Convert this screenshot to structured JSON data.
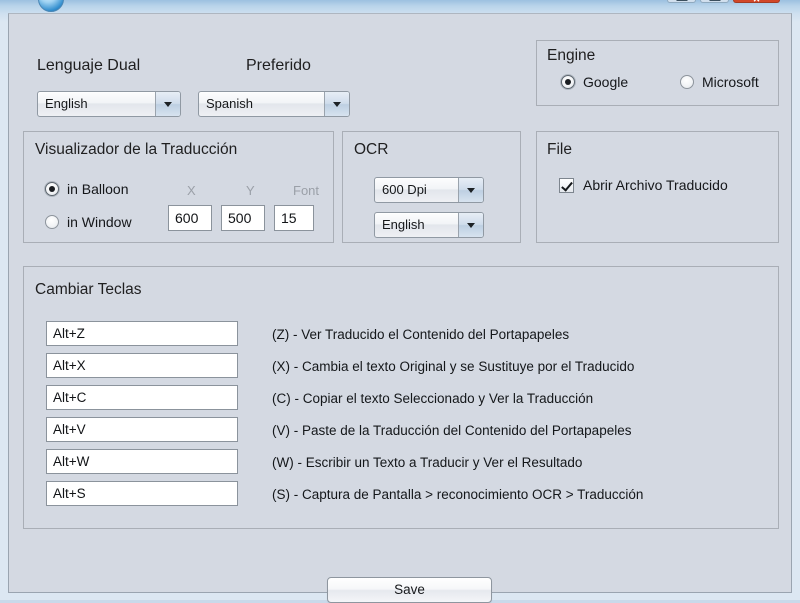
{
  "window": {
    "controls": {
      "minimize": "Minimize",
      "maximize": "Maximize",
      "close": "✕"
    },
    "app_icon": "globe-icon"
  },
  "languages": {
    "dual_label": "Lenguaje Dual",
    "preferred_label": "Preferido",
    "dual_value": "English",
    "preferred_value": "Spanish"
  },
  "viewer": {
    "title": "Visualizador de la Traducción",
    "option_balloon": "in Balloon",
    "option_window": "in Window",
    "balloon_selected": true,
    "x_label": "X",
    "y_label": "Y",
    "font_label": "Font",
    "x_value": "600",
    "y_value": "500",
    "font_value": "15"
  },
  "ocr": {
    "title": "OCR",
    "dpi_value": "600 Dpi",
    "language_value": "English"
  },
  "engine": {
    "title": "Engine",
    "option_google": "Google",
    "option_microsoft": "Microsoft",
    "google_selected": true
  },
  "file": {
    "title": "File",
    "checkbox_label": "Abrir Archivo Traducido",
    "checkbox_checked": true
  },
  "keys": {
    "title": "Cambiar Teclas",
    "rows": [
      {
        "key": "Alt+Z",
        "desc": "(Z) - Ver Traducido el Contenido del Portapapeles"
      },
      {
        "key": "Alt+X",
        "desc": "(X) - Cambia el texto Original y se Sustituye por el Traducido"
      },
      {
        "key": "Alt+C",
        "desc": "(C) - Copiar el texto Seleccionado y Ver la Traducción"
      },
      {
        "key": "Alt+V",
        "desc": "(V) - Paste de la Traducción del Contenido del Portapapeles"
      },
      {
        "key": "Alt+W",
        "desc": "(W) - Escribir un Texto a Traducir y Ver el Resultado"
      },
      {
        "key": "Alt+S",
        "desc": "(S) - Captura de Pantalla > reconocimiento OCR > Traducción"
      }
    ]
  },
  "actions": {
    "save_label": "Save"
  }
}
